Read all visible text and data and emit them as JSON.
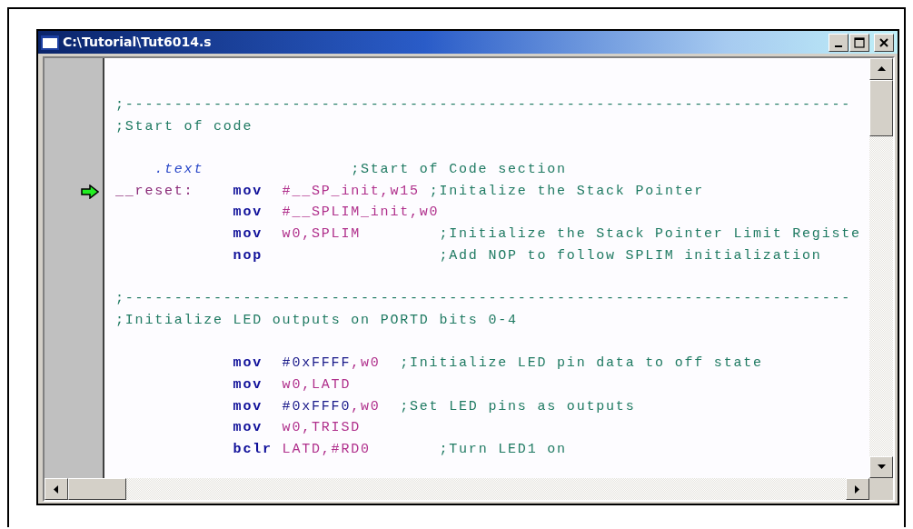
{
  "window": {
    "title": "C:\\Tutorial\\Tut6014.s"
  },
  "editor": {
    "lines": [
      {
        "current": false,
        "tokens": [
          {
            "kind": "comment",
            "text": ";--------------------------------------------------------------------------"
          }
        ]
      },
      {
        "current": false,
        "tokens": [
          {
            "kind": "comment",
            "text": ";Start of code"
          }
        ]
      },
      {
        "current": false
      },
      {
        "current": false,
        "tokens": [
          {
            "kind": "directive",
            "text": ".text"
          },
          {
            "kind": "comment",
            "text": ";Start of Code section"
          }
        ]
      },
      {
        "current": true,
        "tokens": [
          {
            "kind": "label",
            "text": "__reset:"
          },
          {
            "kind": "mnemonic",
            "text": "mov"
          },
          {
            "kind": "operand",
            "text": "#__SP_init,w15"
          },
          {
            "kind": "comment",
            "text": ";Initalize the Stack Pointer"
          }
        ]
      },
      {
        "current": false,
        "tokens": [
          {
            "kind": "mnemonic",
            "text": "mov"
          },
          {
            "kind": "operand",
            "text": "#__SPLIM_init,w0"
          }
        ]
      },
      {
        "current": false,
        "tokens": [
          {
            "kind": "mnemonic",
            "text": "mov"
          },
          {
            "kind": "operand",
            "text": "w0,SPLIM"
          },
          {
            "kind": "comment",
            "text": ";Initialize the Stack Pointer Limit Registe"
          }
        ]
      },
      {
        "current": false,
        "tokens": [
          {
            "kind": "mnemonic",
            "text": "nop"
          },
          {
            "kind": "comment",
            "text": ";Add NOP to follow SPLIM initialization"
          }
        ]
      },
      {
        "current": false
      },
      {
        "current": false,
        "tokens": [
          {
            "kind": "comment",
            "text": ";--------------------------------------------------------------------------"
          }
        ]
      },
      {
        "current": false,
        "tokens": [
          {
            "kind": "comment",
            "text": ";Initialize LED outputs on PORTD bits 0-4"
          }
        ]
      },
      {
        "current": false
      },
      {
        "current": false,
        "tokens": [
          {
            "kind": "mnemonic",
            "text": "mov"
          },
          {
            "kind": "number",
            "text": "#0xFFFF"
          },
          {
            "kind": "operand",
            "text": ",w0"
          },
          {
            "kind": "comment",
            "text": ";Initialize LED pin data to off state"
          }
        ]
      },
      {
        "current": false,
        "tokens": [
          {
            "kind": "mnemonic",
            "text": "mov"
          },
          {
            "kind": "operand",
            "text": "w0,LATD"
          }
        ]
      },
      {
        "current": false,
        "tokens": [
          {
            "kind": "mnemonic",
            "text": "mov"
          },
          {
            "kind": "number",
            "text": "#0xFFF0"
          },
          {
            "kind": "operand",
            "text": ",w0"
          },
          {
            "kind": "comment",
            "text": ";Set LED pins as outputs"
          }
        ]
      },
      {
        "current": false,
        "tokens": [
          {
            "kind": "mnemonic",
            "text": "mov"
          },
          {
            "kind": "operand",
            "text": "w0,TRISD"
          }
        ]
      },
      {
        "current": false,
        "tokens": [
          {
            "kind": "mnemonic",
            "text": "bclr"
          },
          {
            "kind": "operand",
            "text": "LATD,#RD0"
          },
          {
            "kind": "comment",
            "text": ";Turn LED1 on"
          }
        ]
      }
    ]
  }
}
